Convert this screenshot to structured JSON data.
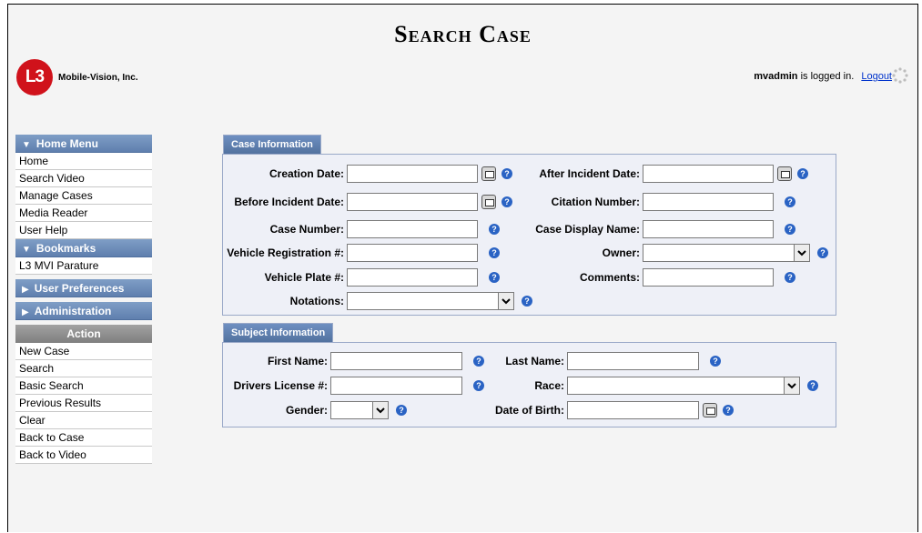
{
  "header": {
    "title": "Search Case",
    "logo_mark": "L3",
    "logo_text": "Mobile-Vision, Inc.",
    "username": "mvadmin",
    "login_suffix": "is logged in.",
    "logout_label": "Logout"
  },
  "sidebar": {
    "home_menu": {
      "title": "Home Menu",
      "items": [
        "Home",
        "Search Video",
        "Manage Cases",
        "Media Reader",
        "User Help"
      ]
    },
    "bookmarks": {
      "title": "Bookmarks",
      "items": [
        "L3 MVI Parature"
      ]
    },
    "user_preferences": {
      "title": "User Preferences"
    },
    "administration": {
      "title": "Administration"
    },
    "action": {
      "title": "Action",
      "items": [
        "New Case",
        "Search",
        "Basic Search",
        "Previous Results",
        "Clear",
        "Back to Case",
        "Back to Video"
      ]
    }
  },
  "case_info": {
    "tab": "Case Information",
    "creation_date": "Creation Date:",
    "after_incident_date": "After Incident Date:",
    "before_incident_date": "Before Incident Date:",
    "citation_number": "Citation Number:",
    "case_number": "Case Number:",
    "case_display_name": "Case Display Name:",
    "vehicle_registration": "Vehicle Registration #:",
    "owner": "Owner:",
    "vehicle_plate": "Vehicle Plate #:",
    "comments": "Comments:",
    "notations": "Notations:"
  },
  "subject_info": {
    "tab": "Subject Information",
    "first_name": "First Name:",
    "last_name": "Last Name:",
    "drivers_license": "Drivers License #:",
    "race": "Race:",
    "gender": "Gender:",
    "date_of_birth": "Date of Birth:"
  },
  "icons": {
    "help": "help-question-icon",
    "calendar": "calendar-icon",
    "dropdown": "chevron-down-icon",
    "collapse": "triangle-down-icon",
    "expand": "triangle-right-icon"
  },
  "colors": {
    "header_blue": "#5f7fae",
    "action_gray": "#7f7f7f",
    "logo_red": "#d0121b",
    "link_blue": "#0033cc"
  }
}
